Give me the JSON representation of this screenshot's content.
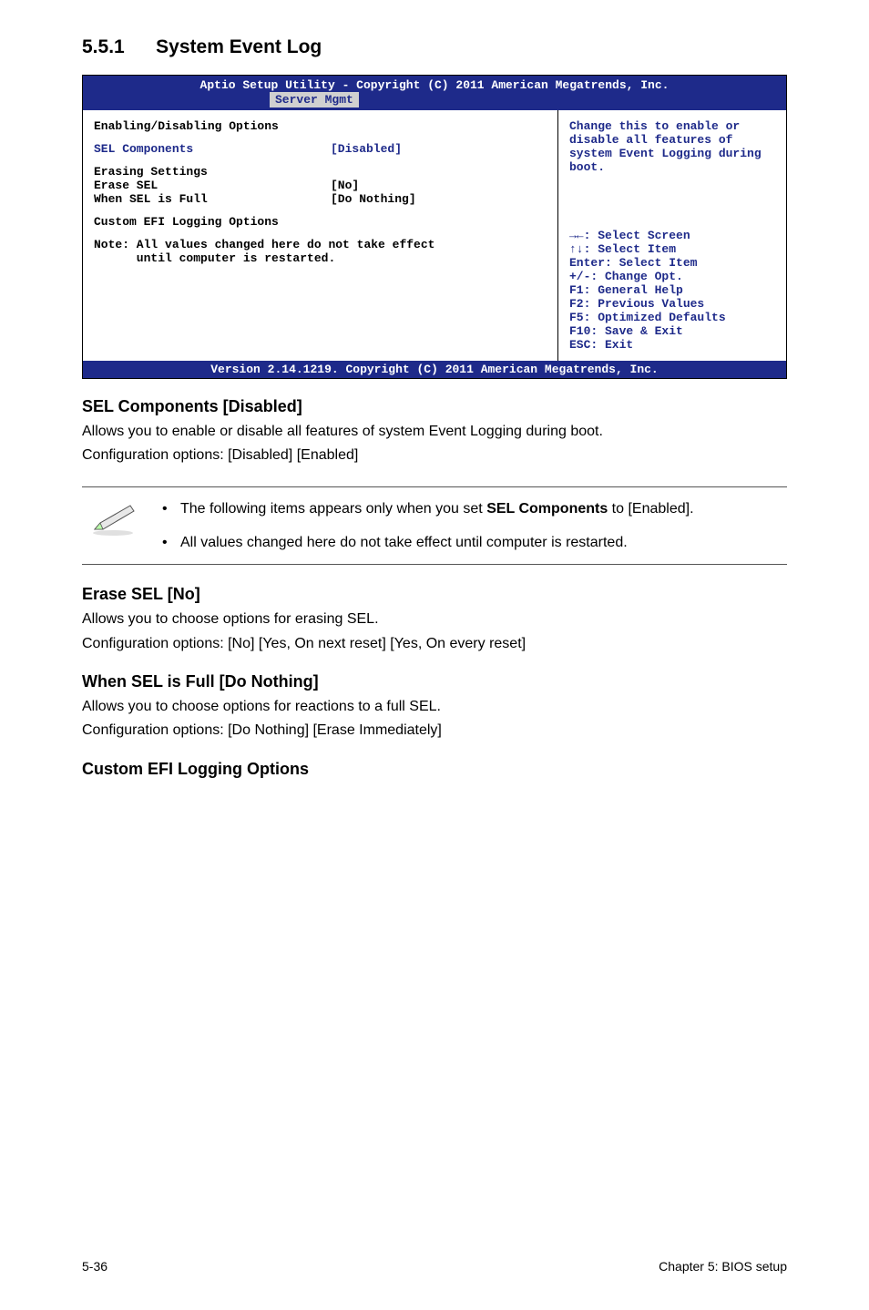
{
  "section": {
    "number": "5.5.1",
    "title": "System Event Log"
  },
  "bios": {
    "header": "Aptio Setup Utility - Copyright (C) 2011 American Megatrends, Inc.",
    "tab": "Server Mgmt",
    "group1": "Enabling/Disabling Options",
    "sel_label": "SEL Components",
    "sel_value": "[Disabled]",
    "group2": "Erasing Settings",
    "erase_label": "Erase SEL",
    "erase_value": "[No]",
    "full_label": "When SEL is Full",
    "full_value": "[Do Nothing]",
    "custom": "Custom EFI Logging Options",
    "note1": "Note: All values changed here do not take effect",
    "note2": "      until computer is restarted.",
    "help_text": "Change this to enable or disable all features of system Event Logging during boot.",
    "nav1": "→←: Select Screen",
    "nav2": "↑↓:  Select Item",
    "nav3": "Enter: Select Item",
    "nav4": "+/-: Change Opt.",
    "nav5": "F1: General Help",
    "nav6": "F2: Previous Values",
    "nav7": "F5: Optimized Defaults",
    "nav8": "F10: Save & Exit",
    "nav9": "ESC: Exit",
    "footer": "Version 2.14.1219. Copyright (C) 2011 American Megatrends, Inc."
  },
  "sub1": {
    "heading": "SEL Components [Disabled]",
    "p1": "Allows you to enable or disable all features of system Event Logging during boot.",
    "p2": "Configuration options: [Disabled] [Enabled]"
  },
  "note": {
    "item1a": "The following items appears only when you set ",
    "item1b": "SEL Components",
    "item1c": " to [Enabled].",
    "item2": "All values changed here do not take effect until computer is restarted."
  },
  "sub2": {
    "heading": "Erase SEL [No]",
    "p1": "Allows you to choose options for erasing SEL.",
    "p2": "Configuration options: [No] [Yes, On next reset] [Yes, On every reset]"
  },
  "sub3": {
    "heading": "When SEL is Full [Do Nothing]",
    "p1": "Allows you to choose options for reactions to a full SEL.",
    "p2": "Configuration options: [Do Nothing] [Erase Immediately]"
  },
  "sub4": {
    "heading": "Custom EFI Logging Options"
  },
  "footer": {
    "left": "5-36",
    "right": "Chapter 5: BIOS setup"
  }
}
